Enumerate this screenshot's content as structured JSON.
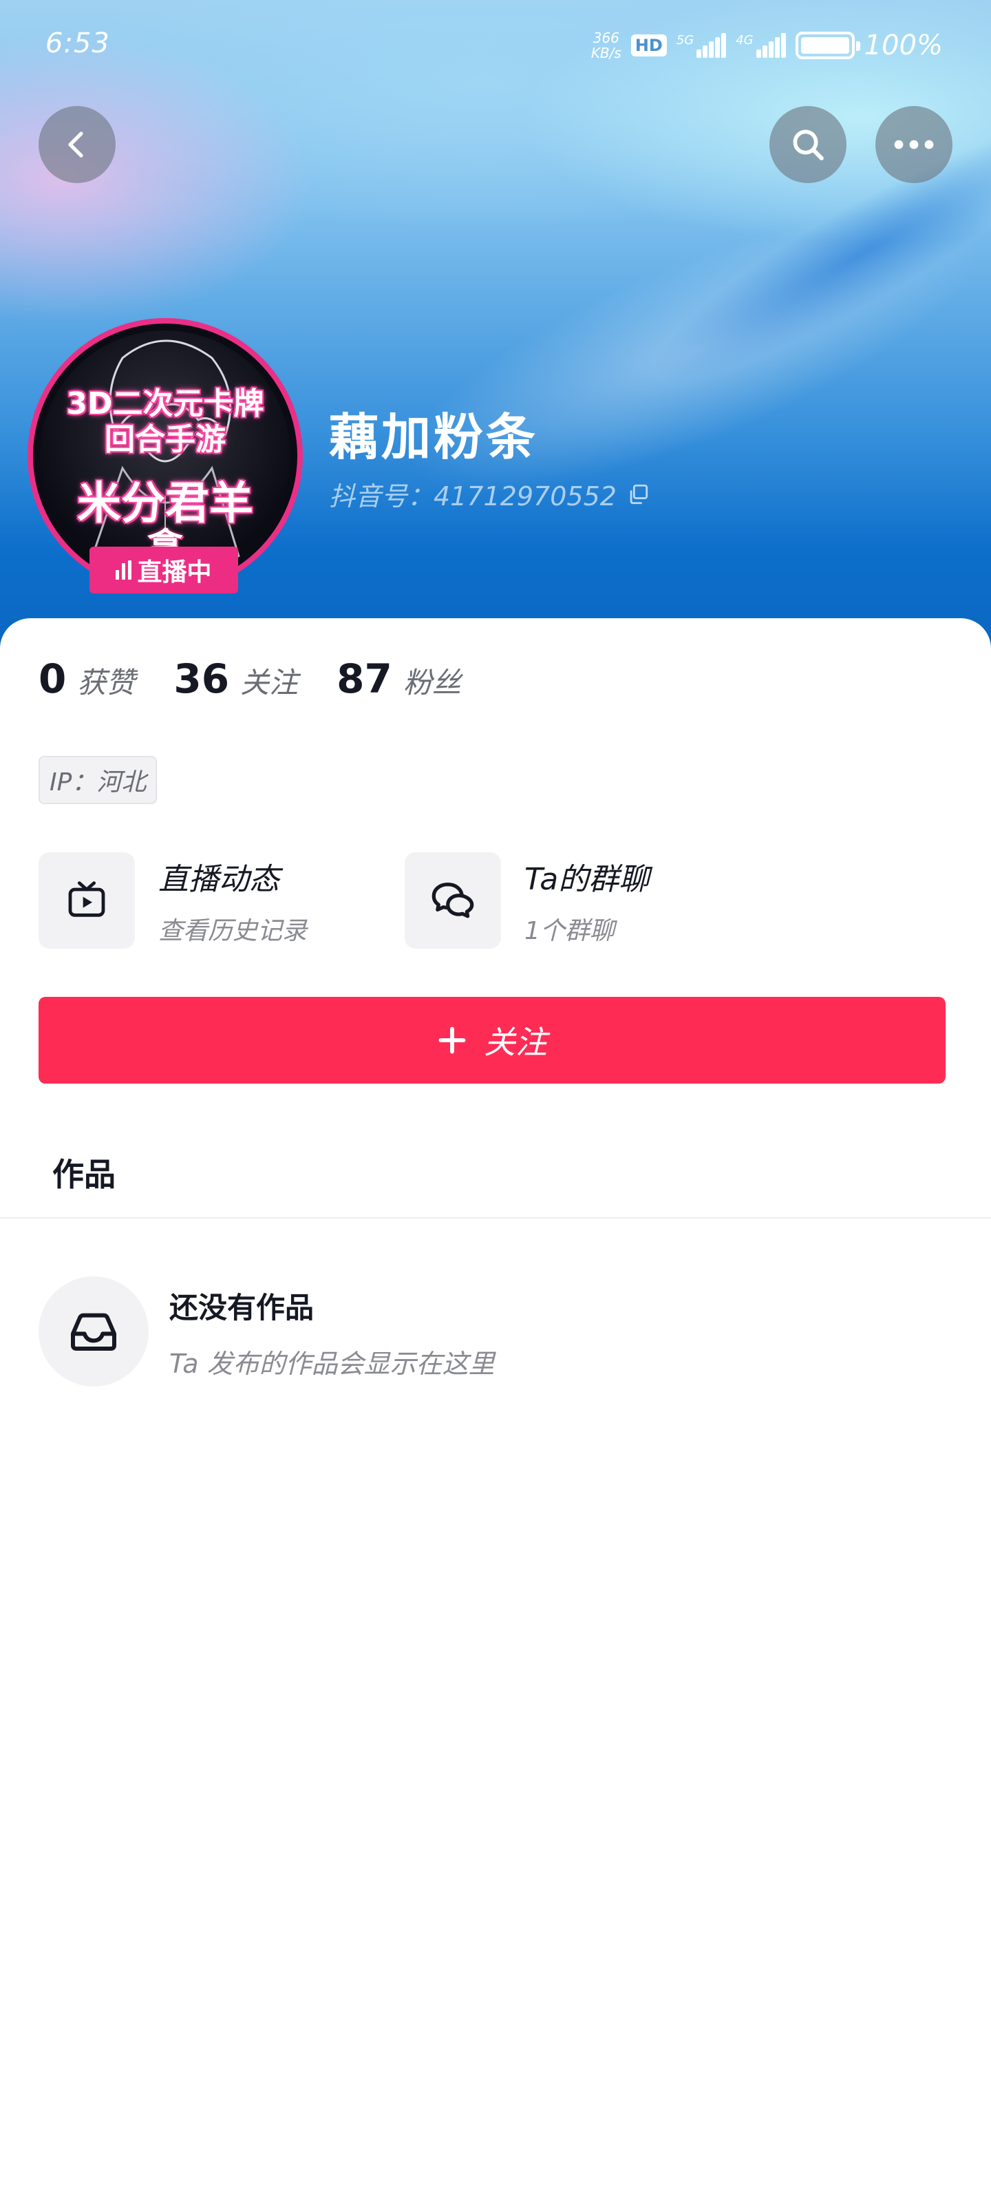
{
  "status_bar": {
    "time": "6:53",
    "speed_value": "366",
    "speed_unit": "KB/s",
    "hd_badge": "HD",
    "net_5g": "5G",
    "net_4g": "4G",
    "battery": "100%"
  },
  "header": {
    "back_icon": "chevron-left-icon",
    "search_icon": "search-icon",
    "more_icon": "more-horizontal-icon"
  },
  "profile": {
    "avatar_text_line1": "3D二次元卡牌",
    "avatar_text_line2": "回合手游",
    "avatar_text_line3": "米分君羊",
    "avatar_text_line4": "拿",
    "live_badge": "直播中",
    "nickname": "藕加粉条",
    "douyin_id": "抖音号：41712970552"
  },
  "stats": [
    {
      "value": "0",
      "label": "获赞"
    },
    {
      "value": "36",
      "label": "关注"
    },
    {
      "value": "87",
      "label": "粉丝"
    }
  ],
  "ip_tag": "IP：河北",
  "features": {
    "live": {
      "title": "直播动态",
      "subtitle": "查看历史记录",
      "icon": "tv-play-icon"
    },
    "group": {
      "title": "Ta的群聊",
      "subtitle": "1个群聊",
      "icon": "chat-bubbles-icon"
    }
  },
  "follow_button": {
    "label": "关注",
    "icon": "plus-icon"
  },
  "tabs": {
    "works": "作品"
  },
  "empty_state": {
    "title": "还没有作品",
    "subtitle": "Ta 发布的作品会显示在这里",
    "icon": "inbox-icon"
  },
  "colors": {
    "accent": "#fe2c55",
    "live_pink": "#ec2d83",
    "banner_blue": "#0a66c2"
  }
}
